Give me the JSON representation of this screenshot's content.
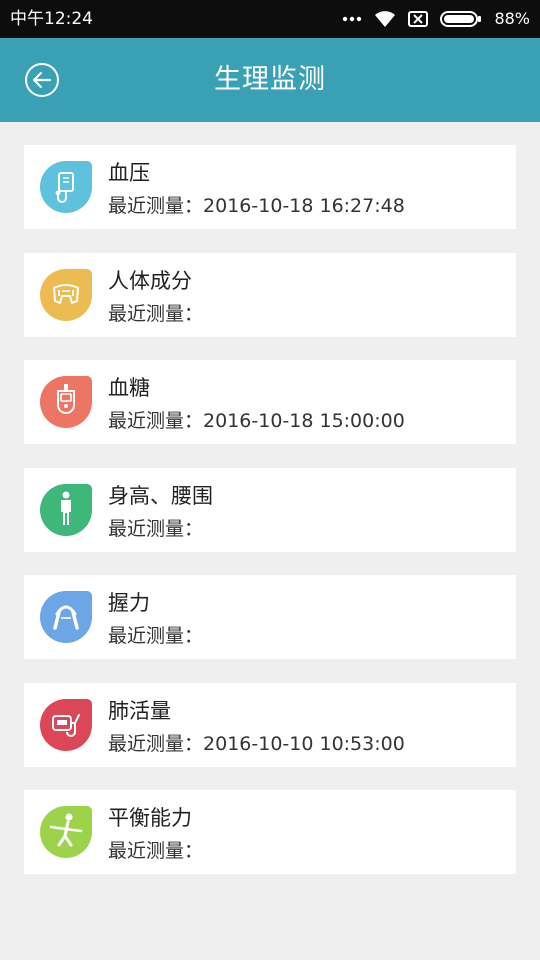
{
  "status_bar": {
    "time": "中午12:24",
    "battery_percent": "88%",
    "icons": [
      "more-dots-icon",
      "wifi-icon",
      "no-sim-icon",
      "battery-icon"
    ]
  },
  "header": {
    "title": "生理监测",
    "back_icon": "back-arrow-icon",
    "background": "#3aa1b5"
  },
  "items": [
    {
      "key": "blood-pressure",
      "title": "血压",
      "sub_label": "最近测量：",
      "last_measured": "2016-10-18 16:27:48",
      "icon": "blood-pressure-icon",
      "color": "#5ec1dd"
    },
    {
      "key": "body-composition",
      "title": "人体成分",
      "sub_label": "最近测量：",
      "last_measured": "",
      "icon": "body-composition-icon",
      "color": "#ecbc53"
    },
    {
      "key": "blood-sugar",
      "title": "血糖",
      "sub_label": "最近测量：",
      "last_measured": "2016-10-18 15:00:00",
      "icon": "glucometer-icon",
      "color": "#ec7564"
    },
    {
      "key": "height-waist",
      "title": "身高、腰围",
      "sub_label": "最近测量：",
      "last_measured": "",
      "icon": "person-standing-icon",
      "color": "#3db77a"
    },
    {
      "key": "grip",
      "title": "握力",
      "sub_label": "最近测量：",
      "last_measured": "",
      "icon": "hand-grip-icon",
      "color": "#6ca6e6"
    },
    {
      "key": "lung-capacity",
      "title": "肺活量",
      "sub_label": "最近测量：",
      "last_measured": "2016-10-10 10:53:00",
      "icon": "spirometer-icon",
      "color": "#dc4758"
    },
    {
      "key": "balance",
      "title": "平衡能力",
      "sub_label": "最近测量：",
      "last_measured": "",
      "icon": "balance-person-icon",
      "color": "#9dd34b"
    }
  ]
}
